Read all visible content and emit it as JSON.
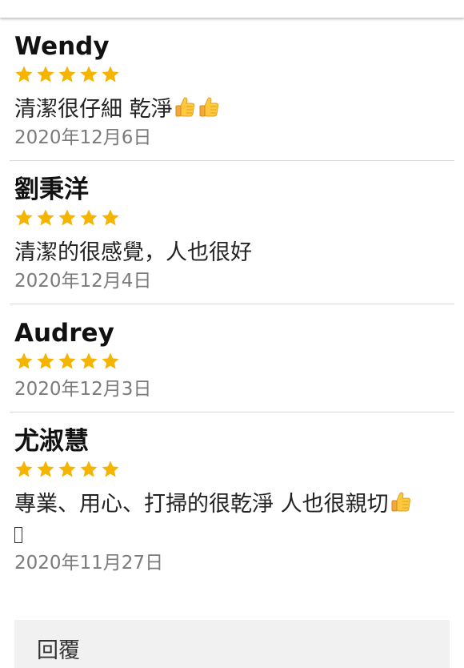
{
  "reviews": [
    {
      "name": "Wendy",
      "rating": 5,
      "comment": "清潔很仔細 乾淨",
      "emoji_count": 2,
      "date": "2020年12月6日"
    },
    {
      "name": "劉秉洋",
      "rating": 5,
      "comment": "清潔的很感覺，人也很好",
      "emoji_count": 0,
      "date": "2020年12月4日"
    },
    {
      "name": "Audrey",
      "rating": 5,
      "comment": "",
      "emoji_count": 0,
      "date": "2020年12月3日"
    },
    {
      "name": "尤淑慧",
      "rating": 5,
      "comment": "專業、用心、打掃的很乾淨 人也很親切",
      "emoji_count": 1,
      "date": "2020年11月27日"
    }
  ],
  "reply": {
    "label": "回覆"
  },
  "colors": {
    "star": "#F4B400",
    "divider": "#d9d9d9",
    "date_text": "#7a7a7a",
    "reply_bg": "#f1f1f1"
  },
  "icons": {
    "rating_star": "star-icon",
    "thumbs_up": "thumbs-up-emoji"
  }
}
